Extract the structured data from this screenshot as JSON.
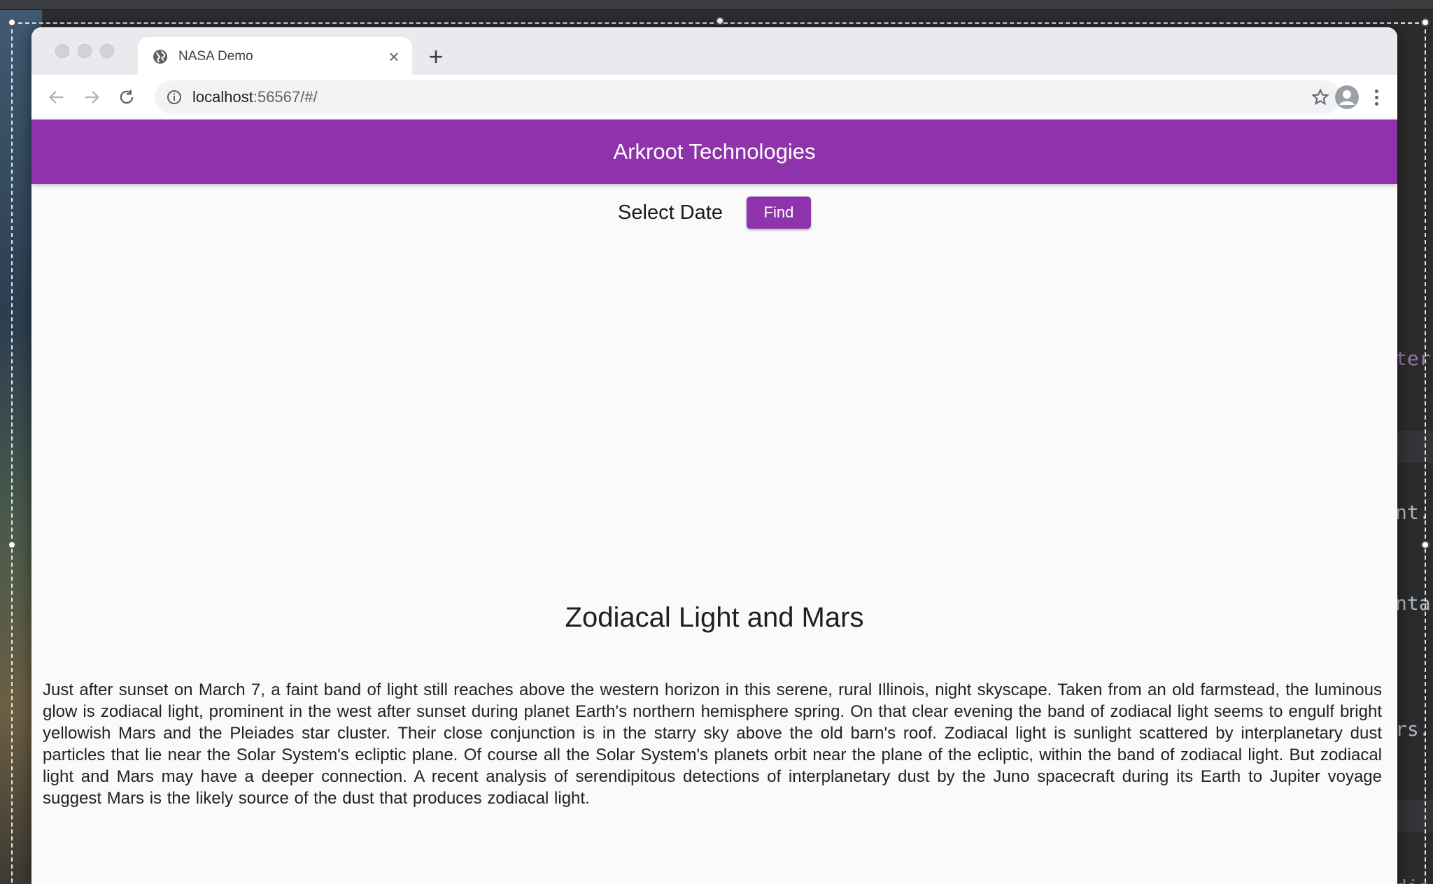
{
  "browser": {
    "tab_title": "NASA Demo",
    "url_host": "localhost",
    "url_rest": ":56567/#/"
  },
  "app": {
    "title": "Arkroot Technologies",
    "select_date_label": "Select Date",
    "find_button": "Find",
    "apod_title": "Zodiacal Light and Mars",
    "apod_explanation": "Just after sunset on March 7, a faint band of light still reaches above the western horizon in this serene, rural Illinois, night skyscape. Taken from an old farmstead, the luminous glow is zodiacal light, prominent in the west after sunset during planet Earth's northern hemisphere spring. On that clear evening the band of zodiacal light seems to engulf bright yellowish Mars and the Pleiades star cluster. Their close conjunction is in the starry sky above the old barn's roof. Zodiacal light is sunlight scattered by interplanetary dust particles that lie near the Solar System's ecliptic plane. Of course all the Solar System's planets orbit near the plane of the ecliptic, within the band of zodiacal light. But zodiacal light and Mars may have a deeper connection. A recent analysis of serendipitous detections of interplanetary dust by the Juno spacecraft during its Earth to Jupiter voyage suggest Mars is the likely source of the dust that produces zodiacal light."
  },
  "background_editor": {
    "snippets": [
      "ter",
      "nt.",
      "nta",
      "rs.",
      "dia"
    ]
  },
  "colors": {
    "accent": "#8e33ab",
    "page_background": "#fafafa"
  }
}
